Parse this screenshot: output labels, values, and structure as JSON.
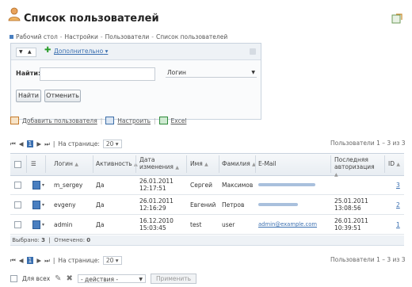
{
  "page": {
    "title": "Список пользователей"
  },
  "breadcrumb": [
    "Рабочий стол",
    "Настройки",
    "Пользователи",
    "Список пользователей"
  ],
  "filter": {
    "extra_label": "Дополнительно",
    "find_label": "Найти:",
    "find_value": "",
    "field_select": "Логин",
    "btn_find": "Найти",
    "btn_cancel": "Отменить"
  },
  "actions": {
    "add_user": "Добавить пользователя",
    "configure": "Настроить",
    "excel": "Excel"
  },
  "pager": {
    "pages": "1",
    "per_page_label": "На странице:",
    "per_page": "20",
    "info": "Пользователи 1 – 3 из 3"
  },
  "columns": [
    "Логин",
    "Активность",
    "Дата изменения",
    "Имя",
    "Фамилия",
    "E-Mail",
    "Последняя авторизация",
    "ID"
  ],
  "rows": [
    {
      "login": "m_sergey",
      "active": "Да",
      "date_changed": "26.01.2011 12:17:51",
      "name": "Сергей",
      "surname": "Максимов",
      "email": "",
      "last_auth": "",
      "id": "3"
    },
    {
      "login": "evgeny",
      "active": "Да",
      "date_changed": "26.01.2011 12:16:29",
      "name": "Евгений",
      "surname": "Петров",
      "email": "",
      "last_auth": "25.01.2011 13:08:56",
      "id": "2"
    },
    {
      "login": "admin",
      "active": "Да",
      "date_changed": "16.12.2010 15:03:45",
      "name": "test",
      "surname": "user",
      "email": "admin@example.com",
      "last_auth": "26.01.2011 10:39:51",
      "id": "1"
    }
  ],
  "selection": {
    "selected_label": "Выбрано:",
    "selected": "3",
    "checked_label": "Отмечено:",
    "checked": "0"
  },
  "bottom": {
    "for_all": "Для всех",
    "action_select": "- действия -",
    "apply": "Применить"
  }
}
